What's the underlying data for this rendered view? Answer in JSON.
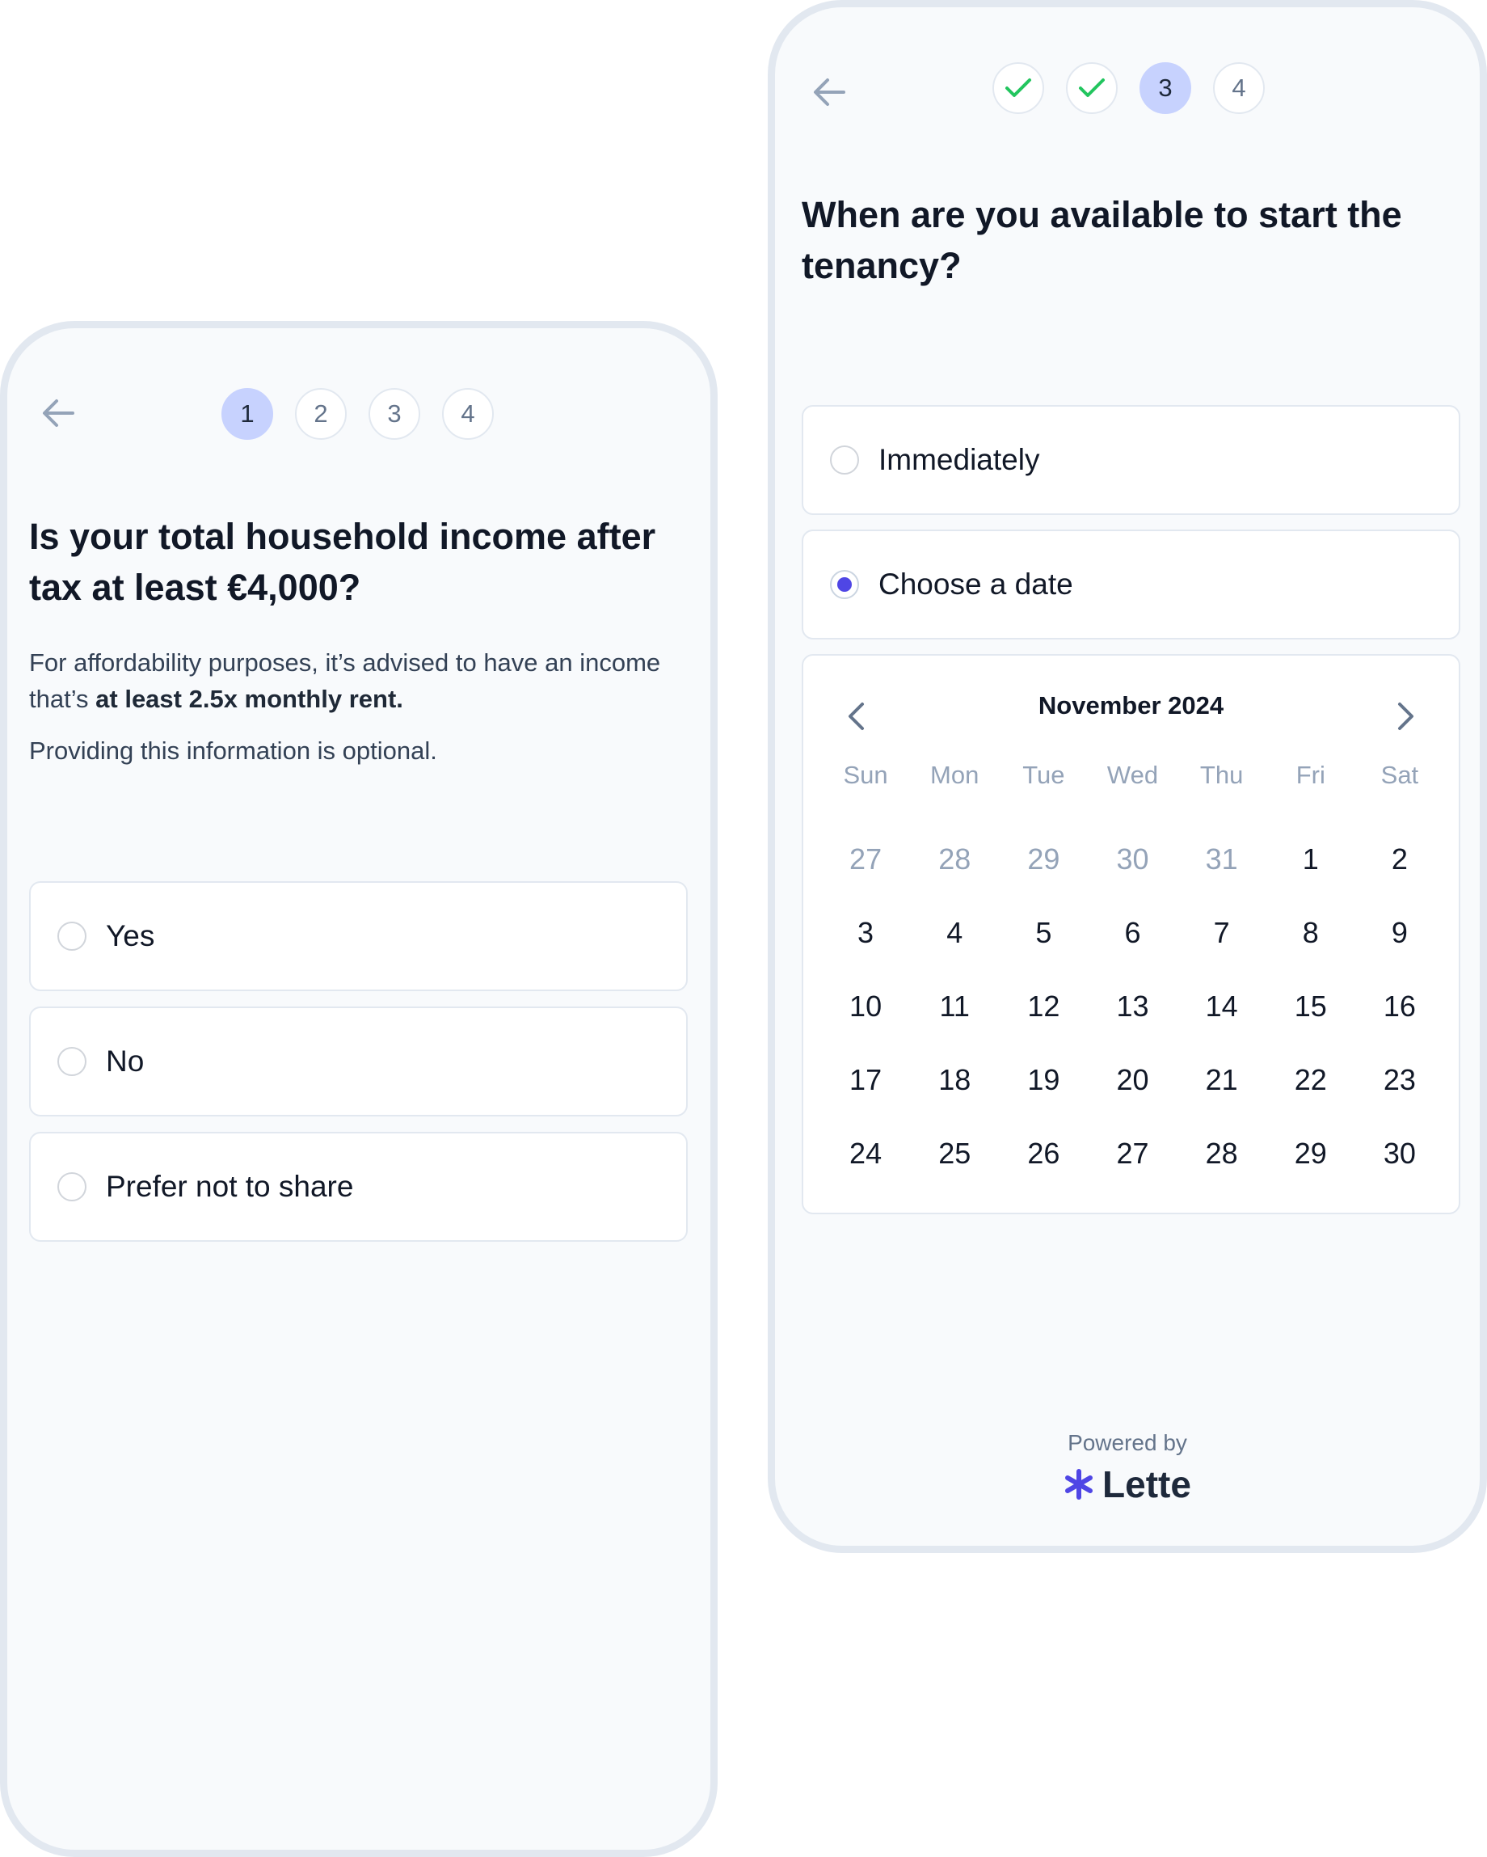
{
  "left_screen": {
    "steps": [
      "1",
      "2",
      "3",
      "4"
    ],
    "current_step": 1,
    "question": "Is your total household income after tax at least €4,000?",
    "description_prefix": "For affordability purposes, it’s advised to have an income that’s ",
    "description_bold": "at least 2.5x monthly rent.",
    "optional_note": "Providing this information is optional.",
    "options": [
      "Yes",
      "No",
      "Prefer not to share"
    ],
    "selected_option": null
  },
  "right_screen": {
    "steps": [
      "✓",
      "✓",
      "3",
      "4"
    ],
    "completed_steps": [
      1,
      2
    ],
    "current_step": 3,
    "question": "When are you available to start the tenancy?",
    "options": [
      "Immediately",
      "Choose a date"
    ],
    "selected_option": "Choose a date",
    "calendar": {
      "month_label": "November 2024",
      "weekdays": [
        "Sun",
        "Mon",
        "Tue",
        "Wed",
        "Thu",
        "Fri",
        "Sat"
      ],
      "leading_days": [
        "27",
        "28",
        "29",
        "30",
        "31"
      ],
      "days": [
        "1",
        "2",
        "3",
        "4",
        "5",
        "6",
        "7",
        "8",
        "9",
        "10",
        "11",
        "12",
        "13",
        "14",
        "15",
        "16",
        "17",
        "18",
        "19",
        "20",
        "21",
        "22",
        "23",
        "24",
        "25",
        "26",
        "27",
        "28",
        "29",
        "30"
      ]
    },
    "footer": {
      "powered_by": "Powered by",
      "brand": "Lette"
    }
  },
  "colors": {
    "accent": "#4f46e5",
    "step_current_bg": "#c7d2fe",
    "check": "#22c55e",
    "frame": "#e2e8f0",
    "screen_bg": "#f8fafc"
  },
  "icons": {
    "back": "arrow-left-icon",
    "completed_step": "check-icon",
    "prev_month": "chevron-left-icon",
    "next_month": "chevron-right-icon",
    "brand_mark": "asterisk-icon"
  }
}
